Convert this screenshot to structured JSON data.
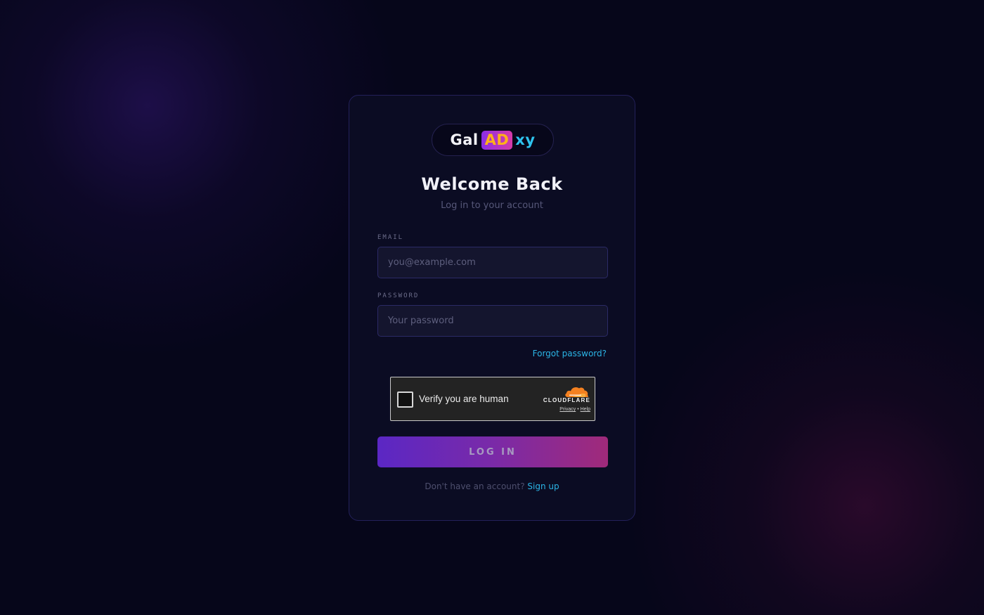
{
  "logo": {
    "part1": "Gal",
    "part2": "AD",
    "part3": "xy"
  },
  "heading": {
    "title": "Welcome Back",
    "subtitle": "Log in to your account"
  },
  "form": {
    "email_label": "EMAIL",
    "email_placeholder": "you@example.com",
    "email_value": "",
    "password_label": "PASSWORD",
    "password_placeholder": "Your password",
    "password_value": "",
    "forgot_link": "Forgot password?",
    "submit_label": "LOG IN"
  },
  "captcha": {
    "label": "Verify you are human",
    "provider": "CLOUDFLARE",
    "privacy": "Privacy",
    "separator": "•",
    "help": "Help",
    "icon": "cloudflare-cloud-icon"
  },
  "signup": {
    "prompt": "Don't have an account?",
    "link": "Sign up"
  },
  "colors": {
    "background": "#06061a",
    "card": "#0b0c23",
    "accent_link": "#2bb5e6",
    "button_gradient_start": "#5b27c4",
    "button_gradient_end": "#a02a7a",
    "cloudflare_orange": "#f48120"
  }
}
